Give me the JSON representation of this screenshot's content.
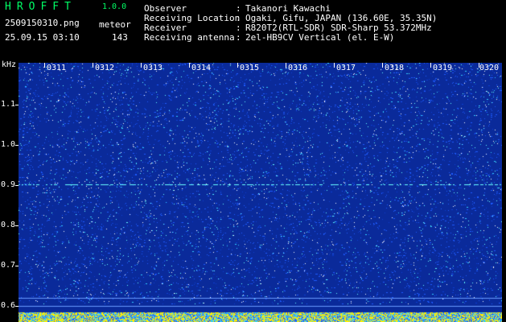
{
  "app": {
    "title": "HROFFT",
    "version": "1.0.0",
    "file_name": "2509150310.png",
    "timestamp": "25.09.15 03:10",
    "meteor_label": "meteor",
    "meteor_count": "143"
  },
  "station_info": [
    {
      "label": "Observer",
      "value": "Takanori Kawachi"
    },
    {
      "label": "Receiving Location",
      "value": "Ogaki, Gifu, JAPAN (136.60E, 35.35N)"
    },
    {
      "label": "Receiver",
      "value": "R820T2(RTL-SDR) SDR-Sharp 53.372MHz"
    },
    {
      "label": "Receiving antenna",
      "value": "2el-HB9CV Vertical (el. E-W)"
    }
  ],
  "spectrogram": {
    "y_unit": "kHz",
    "y_ticks": [
      "1.1",
      "1.0",
      "0.9",
      "0.8",
      "0.7",
      "0.6"
    ],
    "x_ticks": [
      "0311",
      "0312",
      "0313",
      "0314",
      "0315",
      "0316",
      "0317",
      "0318",
      "0319",
      "0320"
    ],
    "colors": {
      "background": "#000000",
      "noise_low": "#0a2a9a",
      "noise_mid": "#1e5cff",
      "noise_high": "#33ccff",
      "signal_line": "#66ffff",
      "bottom_band": "#ffee00"
    }
  }
}
